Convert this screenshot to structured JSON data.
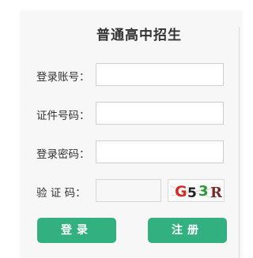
{
  "form": {
    "title": "普通高中招生",
    "account_label": "登录账号：",
    "idcard_label": "证件号码：",
    "password_label": "登录密码：",
    "captcha_label": "验 证 码：",
    "account_value": "",
    "idcard_value": "",
    "password_value": "",
    "captcha_value": ""
  },
  "captcha": {
    "chars": [
      "G",
      "5",
      "3",
      "R"
    ],
    "colors": [
      "#d0302a",
      "#222222",
      "#2a9a3a",
      "#7a2a2a"
    ]
  },
  "buttons": {
    "login": "登录",
    "register": "注册"
  },
  "colors": {
    "accent": "#33b07f",
    "card_bg": "#f7f7f7"
  }
}
